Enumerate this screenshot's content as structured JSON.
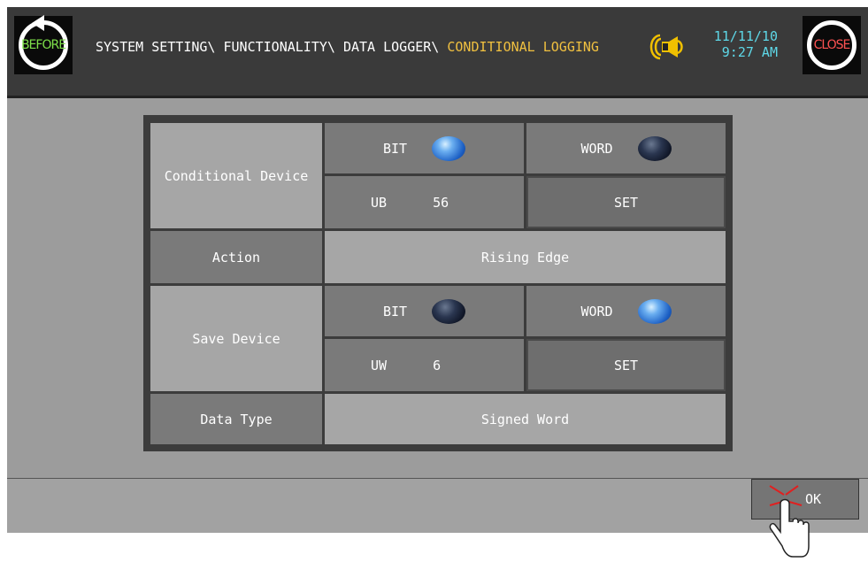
{
  "header": {
    "before_label": "BEFORE",
    "close_label": "CLOSE",
    "breadcrumb_path": "SYSTEM SETTING\\ FUNCTIONALITY\\ DATA LOGGER\\ ",
    "breadcrumb_current": "CONDITIONAL LOGGING",
    "date": "11/11/10",
    "time": "9:27 AM",
    "icons": {
      "before": "undo-arrow-icon",
      "speaker": "speaker-icon",
      "ok": "touch-hand-icon"
    }
  },
  "form": {
    "conditional_device": {
      "label": "Conditional Device",
      "bit_label": "BIT",
      "word_label": "WORD",
      "selected": "BIT",
      "device_type": "UB",
      "device_number": "56",
      "set_label": "SET"
    },
    "action": {
      "label": "Action",
      "value": "Rising Edge"
    },
    "save_device": {
      "label": "Save Device",
      "bit_label": "BIT",
      "word_label": "WORD",
      "selected": "WORD",
      "device_type": "UW",
      "device_number": "6",
      "set_label": "SET"
    },
    "data_type": {
      "label": "Data Type",
      "value": "Signed Word"
    }
  },
  "footer": {
    "ok_label": "OK"
  },
  "colors": {
    "header_bg": "#3a3a3a",
    "breadcrumb_current": "#f0c040",
    "datetime": "#5ed8e8",
    "before_text": "#7ee04a",
    "close_text": "#ff5252",
    "orb_selected": "#1c5fc4",
    "orb_unselected": "#0e1424"
  }
}
